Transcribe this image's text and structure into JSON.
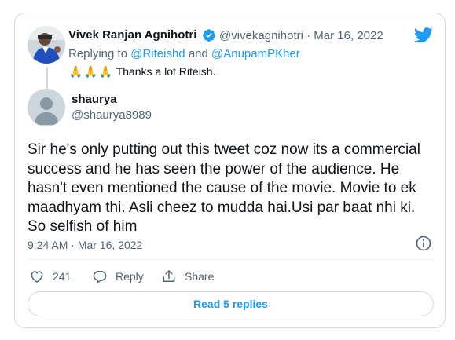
{
  "parent_tweet": {
    "author_name": "Vivek Ranjan Agnihotri",
    "author_handle": "@vivekagnihotri",
    "separator": "·",
    "date": "Mar 16, 2022",
    "replying_prefix": "Replying to",
    "mention_1": "@Riteishd",
    "conjunction": "and",
    "mention_2": "@AnupamPKher",
    "emoji": "🙏",
    "text": "Thanks a lot Riteish."
  },
  "tweet": {
    "author_name": "shaurya",
    "author_handle": "@shaurya8989",
    "text": "Sir he's only putting out this tweet coz now its a commercial success and he has seen the power of the audience. He hasn't even mentioned the cause of the movie. Movie to ek maadhyam thi. Asli cheez to mudda hai.Usi par baat nhi ki. So selfish of him",
    "timestamp": "9:24 AM · Mar 16, 2022",
    "like_count": "241",
    "reply_label": "Reply",
    "share_label": "Share",
    "read_replies_label": "Read 5 replies"
  },
  "icons": {
    "verified": "verified-badge-icon",
    "brand": "twitter-bird-icon",
    "info": "info-icon",
    "like": "heart-icon",
    "reply": "speech-bubble-icon",
    "share": "share-upload-icon"
  },
  "colors": {
    "accent": "#1d9bf0",
    "secondary_text": "#536471",
    "primary_text": "#0f1419",
    "border": "#cfd9de"
  }
}
